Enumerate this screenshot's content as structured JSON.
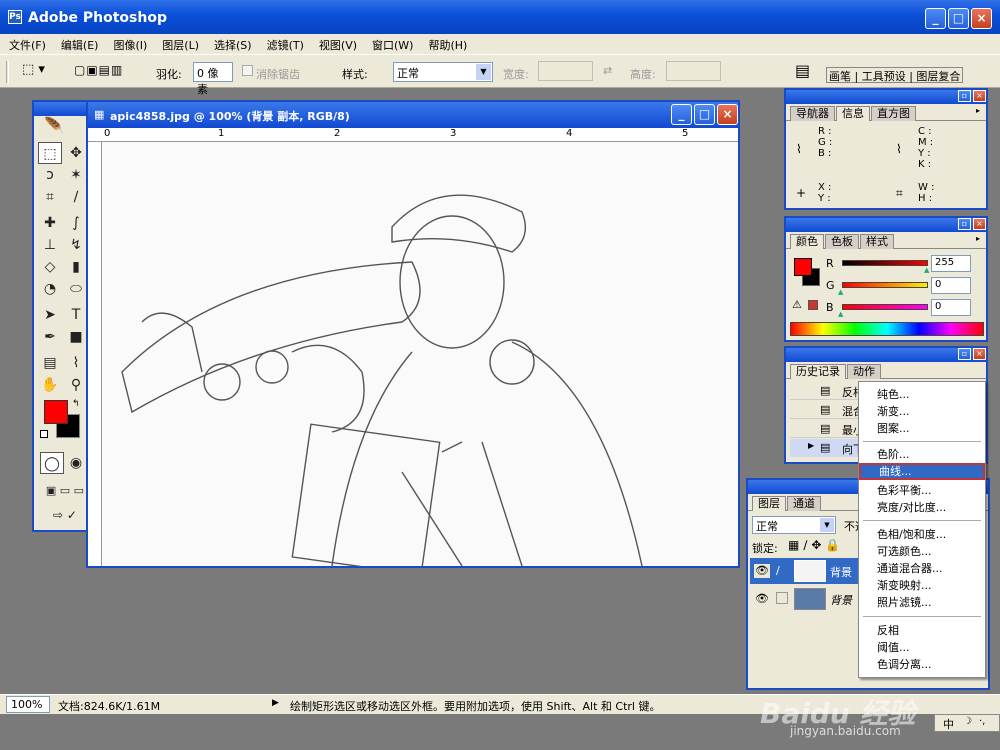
{
  "app": {
    "title": "Adobe Photoshop",
    "icon": "photoshop-icon"
  },
  "menu": [
    "文件(F)",
    "编辑(E)",
    "图像(I)",
    "图层(L)",
    "选择(S)",
    "滤镜(T)",
    "视图(V)",
    "窗口(W)",
    "帮助(H)"
  ],
  "options": {
    "feather_label": "羽化:",
    "feather_value": "0 像素",
    "antialias_label": "消除锯齿",
    "style_label": "样式:",
    "style_value": "正常",
    "width_label": "宽度:",
    "height_label": "高度:",
    "tabs": [
      "画笔",
      "工具预设",
      "图层复合"
    ]
  },
  "document": {
    "title": "apic4858.jpg @ 100% (背景 副本, RGB/8)",
    "ruler_marks": [
      "0",
      "1",
      "2",
      "3",
      "4",
      "5"
    ]
  },
  "navigator": {
    "tabs": [
      "导航器",
      "信息",
      "直方图"
    ],
    "active_tab": "信息",
    "rgb": [
      "R :",
      "G :",
      "B :"
    ],
    "cmyk": [
      "C :",
      "M :",
      "Y :",
      "K :"
    ],
    "xy": [
      "X :",
      "Y :"
    ],
    "wh": [
      "W :",
      "H :"
    ]
  },
  "color_panel": {
    "tabs": [
      "颜色",
      "色板",
      "样式"
    ],
    "channels": [
      {
        "label": "R",
        "value": "255",
        "color": "#ff0000"
      },
      {
        "label": "G",
        "value": "0",
        "color": "#ffcc00"
      },
      {
        "label": "B",
        "value": "0",
        "color": "#cc00cc"
      }
    ],
    "fg": "#ff0000",
    "bg": "#000000"
  },
  "history": {
    "tabs": [
      "历史记录",
      "动作"
    ],
    "items": [
      "反相",
      "混合",
      "最小",
      "向下"
    ]
  },
  "layers": {
    "tabs": [
      "图层",
      "通道"
    ],
    "blend_mode": "正常",
    "opacity_label": "不透",
    "lock_label": "锁定:",
    "items": [
      {
        "name": "背景",
        "italic": false
      },
      {
        "name": "背景",
        "italic": true
      }
    ]
  },
  "context_menu": {
    "items": [
      "纯色...",
      "渐变...",
      "图案...",
      "色阶...",
      "曲线...",
      "色彩平衡...",
      "亮度/对比度...",
      "色相/饱和度...",
      "可选颜色...",
      "通道混合器...",
      "渐变映射...",
      "照片滤镜...",
      "反相",
      "阈值...",
      "色调分离..."
    ],
    "selected": "曲线..."
  },
  "status": {
    "zoom": "100%",
    "doc_info": "文档:824.6K/1.61M",
    "hint": "绘制矩形选区或移动选区外框。要用附加选项，使用 Shift、Alt 和 Ctrl 键。"
  },
  "tray": {
    "ime": "中",
    "watermark": "Baidu 经验",
    "url": "jingyan.baidu.com"
  }
}
